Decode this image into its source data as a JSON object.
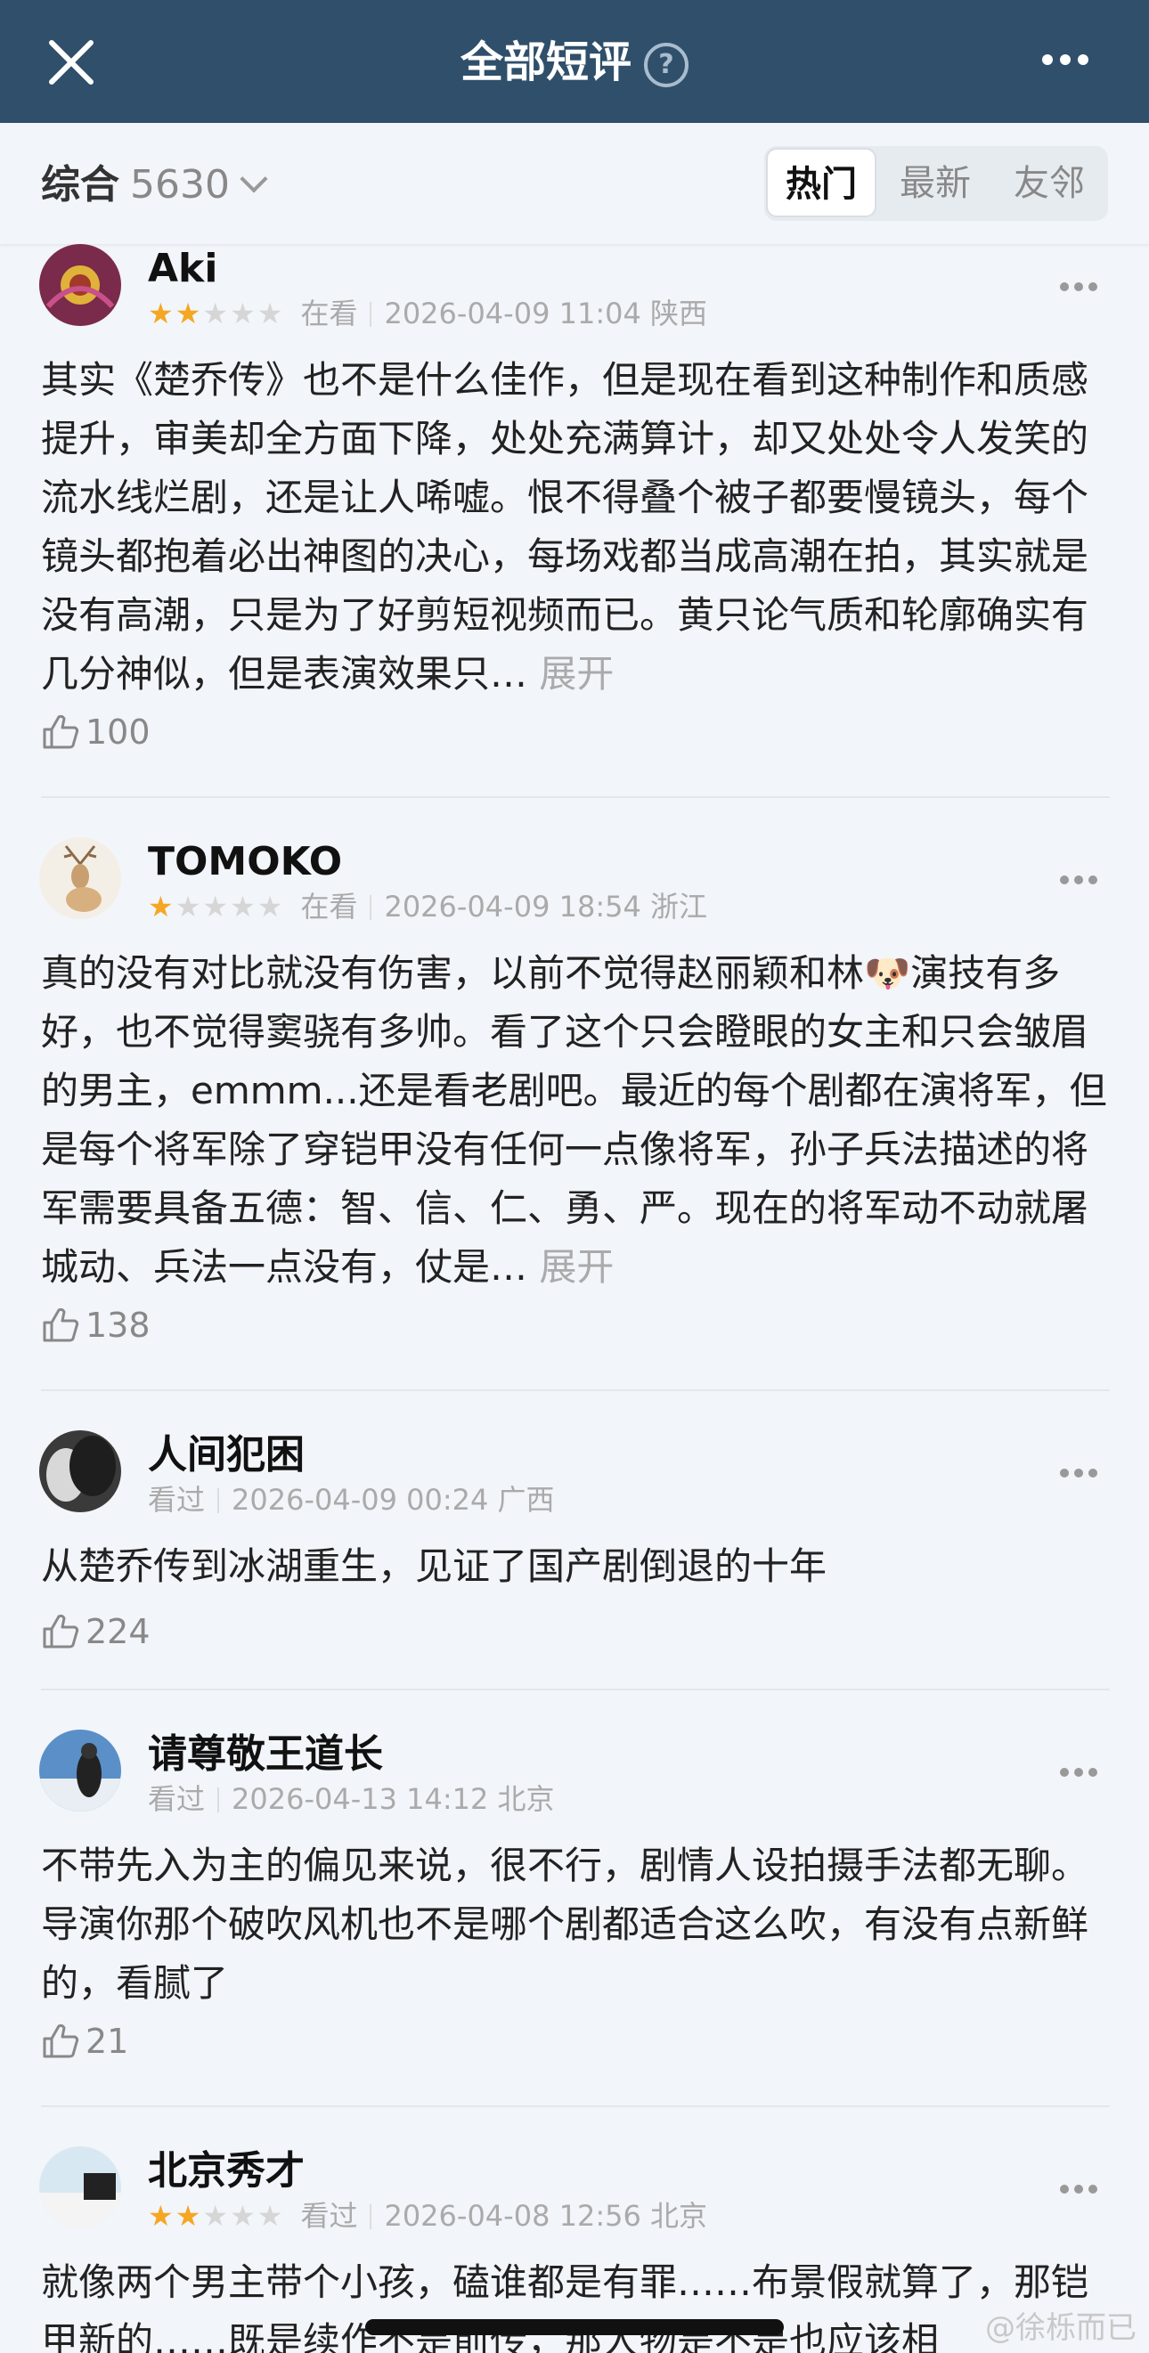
{
  "header": {
    "title": "全部短评",
    "help_glyph": "?",
    "colors": {
      "bar": "#2f4f6b",
      "text": "#ffffff"
    }
  },
  "filter": {
    "sort_label": "综合",
    "count": "5630",
    "tabs": [
      "热门",
      "最新",
      "友邻"
    ],
    "active_tab": "热门"
  },
  "reviews": [
    {
      "user": "Aki",
      "rating": 2,
      "status": "在看",
      "time": "2026-04-09 11:04",
      "location": "陕西",
      "text": "其实《楚乔传》也不是什么佳作，但是现在看到这种制作和质感提升，审美却全方面下降，处处充满算计，却又处处令人发笑的流水线烂剧，还是让人唏嘘。恨不得叠个被子都要慢镜头，每个镜头都抱着必出神图的决心，每场戏都当成高潮在拍，其实就是没有高潮，只是为了好剪短视频而已。黄只论气质和轮廓确实有几分神似，但是表演效果只…",
      "expand": "展开",
      "likes": "100"
    },
    {
      "user": "TOMOKO",
      "rating": 1,
      "status": "在看",
      "time": "2026-04-09 18:54",
      "location": "浙江",
      "text": "真的没有对比就没有伤害，以前不觉得赵丽颖和林🐶演技有多好，也不觉得窦骁有多帅。看了这个只会瞪眼的女主和只会皱眉的男主，emmm...还是看老剧吧。最近的每个剧都在演将军，但是每个将军除了穿铠甲没有任何一点像将军，孙子兵法描述的将军需要具备五德：智、信、仁、勇、严。现在的将军动不动就屠城动、兵法一点没有，仗是…",
      "expand": "展开",
      "likes": "138"
    },
    {
      "user": "人间犯困",
      "rating": 0,
      "status": "看过",
      "time": "2026-04-09 00:24",
      "location": "广西",
      "text": "从楚乔传到冰湖重生，见证了国产剧倒退的十年",
      "expand": "",
      "likes": "224"
    },
    {
      "user": "请尊敬王道长",
      "rating": 0,
      "status": "看过",
      "time": "2026-04-13 14:12",
      "location": "北京",
      "text": "不带先入为主的偏见来说，很不行，剧情人设拍摄手法都无聊。导演你那个破吹风机也不是哪个剧都适合这么吹，有没有点新鲜的，看腻了",
      "expand": "",
      "likes": "21"
    },
    {
      "user": "北京秀才",
      "rating": 2,
      "status": "看过",
      "time": "2026-04-08 12:56",
      "location": "北京",
      "text": "就像两个男主带个小孩，磕谁都是有罪……布景假就算了，那铠甲新的……既是续作不是前传，那人物是不是也应该相",
      "expand": "",
      "likes": ""
    }
  ],
  "watermark": "@徐栎而已"
}
